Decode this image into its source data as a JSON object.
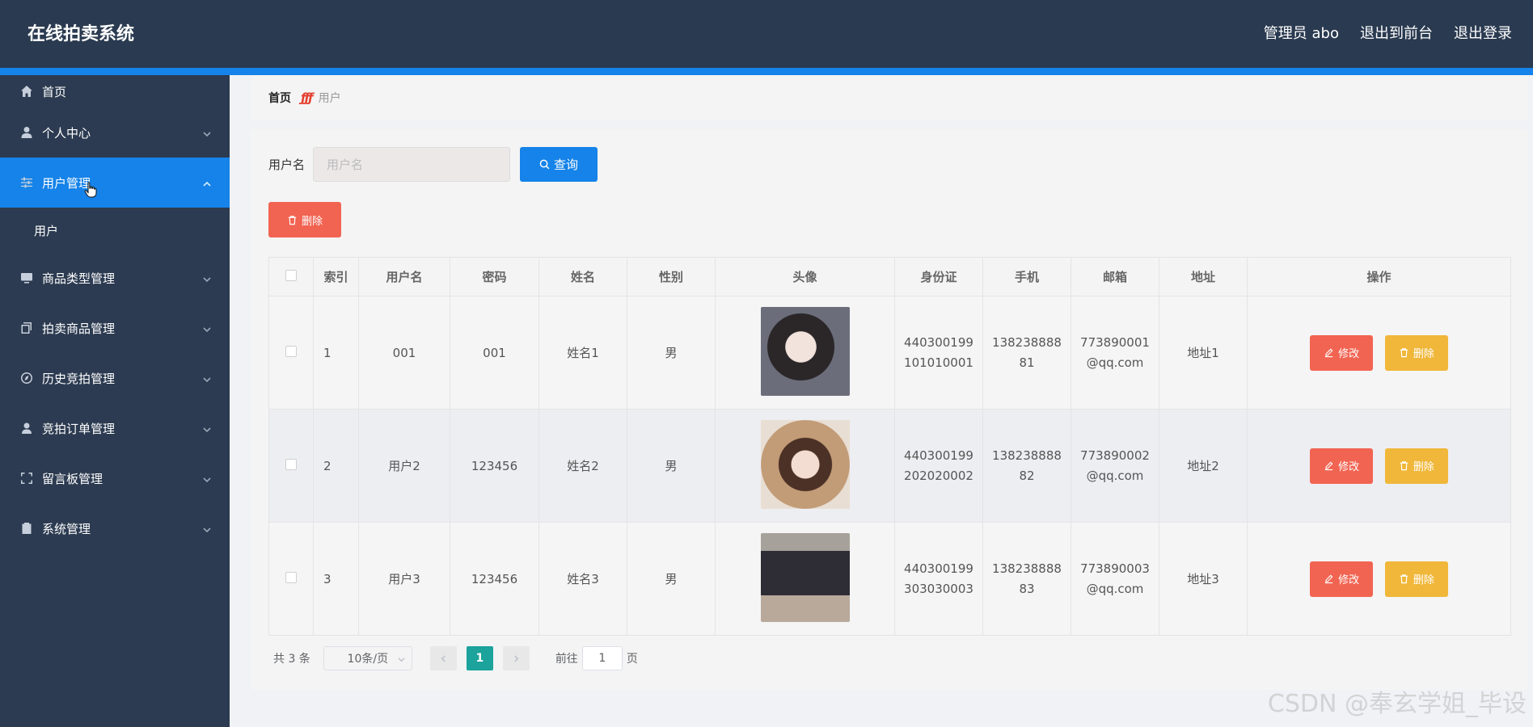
{
  "header": {
    "title": "在线拍卖系统",
    "admin_label": "管理员 abo",
    "to_front_label": "退出到前台",
    "logout_label": "退出登录"
  },
  "colors": {
    "header_bg": "#2a3a50",
    "accent": "#1583e9",
    "sidebar_bg": "#2c3b51",
    "danger": "#f26452",
    "warning": "#f0b73a",
    "pager_active": "#1ba39c"
  },
  "sidebar": {
    "items": [
      {
        "label": "首页",
        "icon": "home-icon"
      },
      {
        "label": "个人中心",
        "icon": "user-icon"
      },
      {
        "label": "用户管理",
        "icon": "sliders-icon",
        "active": true
      },
      {
        "label": "商品类型管理",
        "icon": "monitor-icon"
      },
      {
        "label": "拍卖商品管理",
        "icon": "copy-icon"
      },
      {
        "label": "历史竞拍管理",
        "icon": "compass-icon"
      },
      {
        "label": "竞拍订单管理",
        "icon": "person-icon"
      },
      {
        "label": "留言板管理",
        "icon": "fullscreen-icon"
      },
      {
        "label": "系统管理",
        "icon": "clipboard-icon"
      }
    ],
    "submenu": {
      "label": "用户"
    }
  },
  "breadcrumb": {
    "home": "首页",
    "current": "用户"
  },
  "search": {
    "label": "用户名",
    "placeholder": "用户名",
    "value": "",
    "button": "查询"
  },
  "toolbar": {
    "delete_label": "删除"
  },
  "table": {
    "headers": [
      "",
      "索引",
      "用户名",
      "密码",
      "姓名",
      "性别",
      "头像",
      "身份证",
      "手机",
      "邮箱",
      "地址",
      "操作"
    ],
    "rows": [
      {
        "index": "1",
        "username": "001",
        "password": "001",
        "name": "姓名1",
        "gender": "男",
        "id1": "440300199",
        "id2": "101010001",
        "phone1": "138238888",
        "phone2": "81",
        "email1": "773890001",
        "email2": "@qq.com",
        "address": "地址1"
      },
      {
        "index": "2",
        "username": "用户2",
        "password": "123456",
        "name": "姓名2",
        "gender": "男",
        "id1": "440300199",
        "id2": "202020002",
        "phone1": "138238888",
        "phone2": "82",
        "email1": "773890002",
        "email2": "@qq.com",
        "address": "地址2"
      },
      {
        "index": "3",
        "username": "用户3",
        "password": "123456",
        "name": "姓名3",
        "gender": "男",
        "id1": "440300199",
        "id2": "303030003",
        "phone1": "138238888",
        "phone2": "83",
        "email1": "773890003",
        "email2": "@qq.com",
        "address": "地址3"
      }
    ],
    "edit_label": "修改",
    "delete_label": "删除"
  },
  "pagination": {
    "total": "共 3 条",
    "page_size": "10条/页",
    "current_page": "1",
    "goto_prefix": "前往",
    "goto_value": "1",
    "goto_suffix": "页"
  },
  "watermark": "CSDN @奉玄学姐_毕设"
}
